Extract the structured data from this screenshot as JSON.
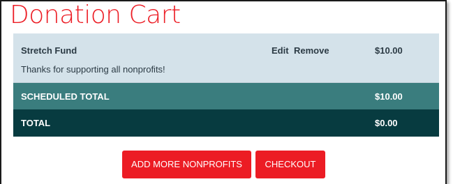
{
  "page": {
    "title": "Donation Cart"
  },
  "cart": {
    "items": [
      {
        "name": "Stretch Fund",
        "note": "Thanks for supporting all nonprofits!",
        "edit_label": "Edit",
        "remove_label": "Remove",
        "amount": "$10.00"
      }
    ],
    "scheduled_total_label": "SCHEDULED TOTAL",
    "scheduled_total_amount": "$10.00",
    "total_label": "TOTAL",
    "total_amount": "$0.00"
  },
  "actions": {
    "add_more_label": "ADD MORE NONPROFITS",
    "checkout_label": "CHECKOUT"
  },
  "colors": {
    "accent_red": "#ec1c24",
    "item_row_bg": "#d4e2ea",
    "scheduled_row_bg": "#3a7d7e",
    "total_row_bg": "#073b40"
  }
}
